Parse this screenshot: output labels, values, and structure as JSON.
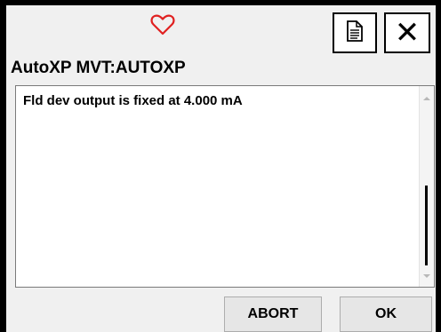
{
  "header": {
    "title": "AutoXP MVT:AUTOXP",
    "status_icon": "heart-outline-icon",
    "status_icon_color": "#e02020"
  },
  "toolbar": {
    "document_icon": "document-icon",
    "close_icon": "close-icon",
    "close_glyph": "✕"
  },
  "message": {
    "text": "Fld dev output is fixed at 4.000 mA"
  },
  "buttons": {
    "abort_label": "ABORT",
    "ok_label": "OK"
  },
  "colors": {
    "frame": "#000000",
    "panel_background": "#f0f0f0",
    "button_background": "#e6e6e6",
    "heart": "#e02020"
  }
}
